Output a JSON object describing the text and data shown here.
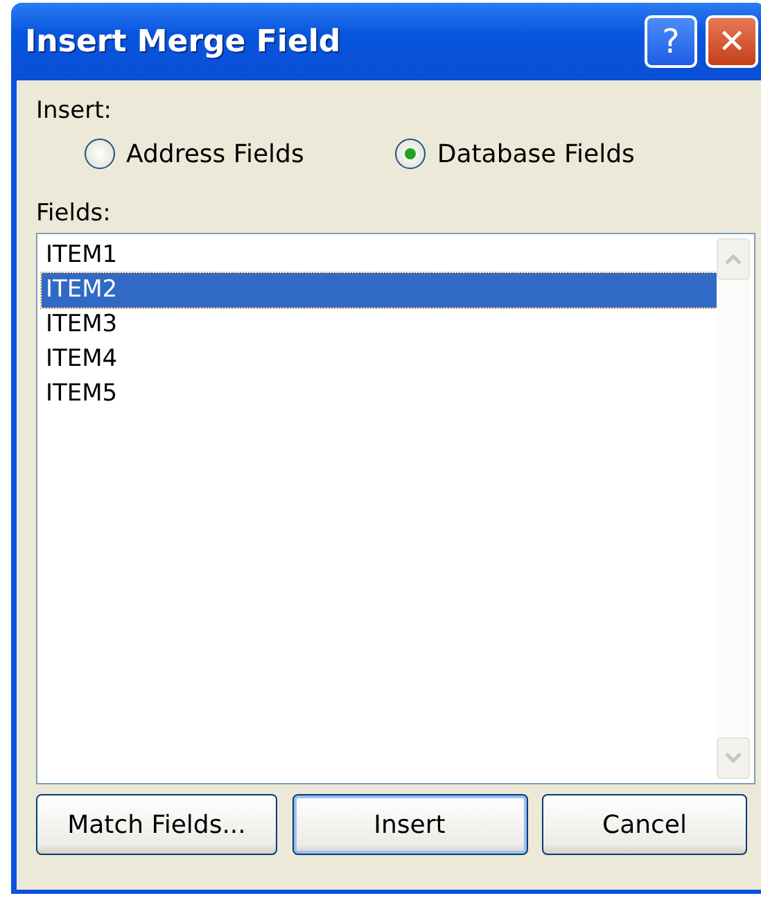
{
  "window": {
    "title": "Insert Merge Field",
    "title_buttons": [
      "?",
      "✕"
    ]
  },
  "insert": {
    "label": "Insert:",
    "options": [
      {
        "label": "Address Fields",
        "selected": false
      },
      {
        "label": "Database Fields",
        "selected": true
      }
    ]
  },
  "fields": {
    "label": "Fields:",
    "items": [
      {
        "label": "ITEM1",
        "selected": false
      },
      {
        "label": "ITEM2",
        "selected": true
      },
      {
        "label": "ITEM3",
        "selected": false
      },
      {
        "label": "ITEM4",
        "selected": false
      },
      {
        "label": "ITEM5",
        "selected": false
      }
    ]
  },
  "buttons": [
    {
      "label": "Match Fields...",
      "default": false
    },
    {
      "label": "Insert",
      "default": true
    },
    {
      "label": "Cancel",
      "default": false
    }
  ]
}
